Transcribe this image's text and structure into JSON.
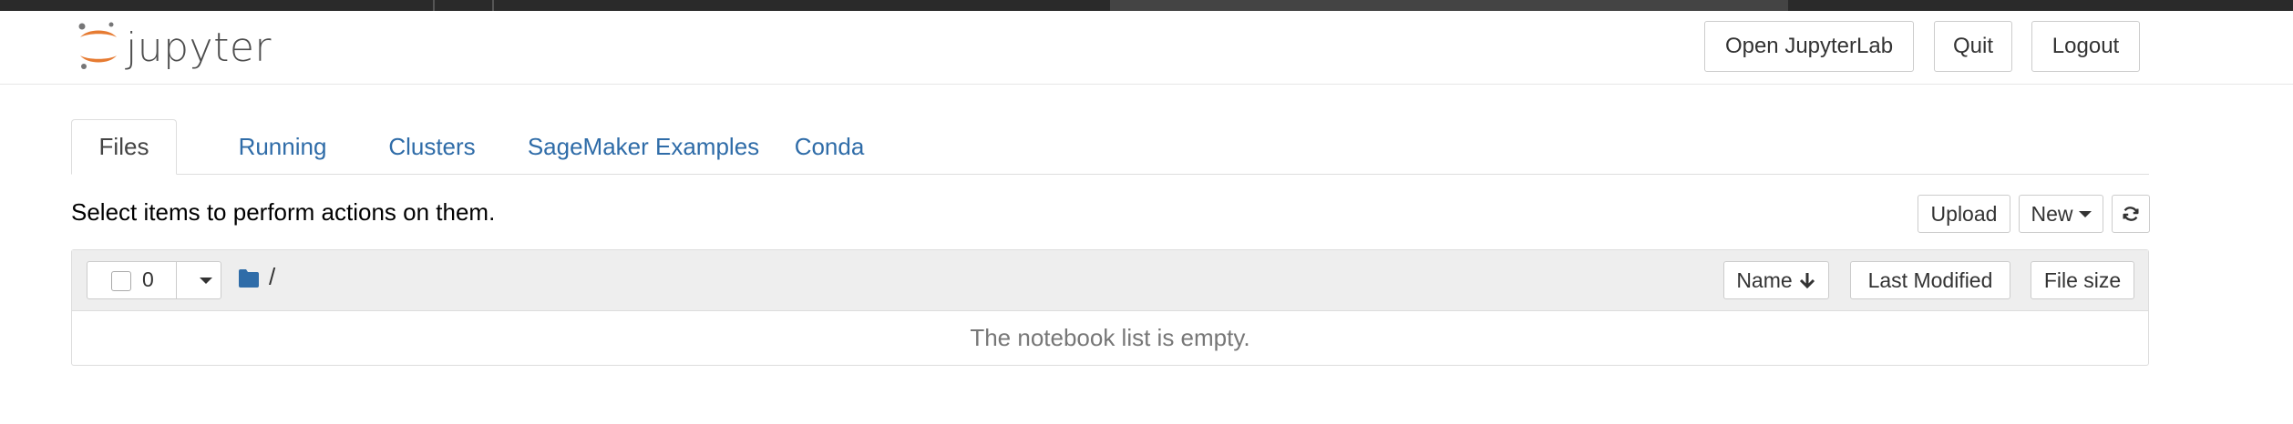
{
  "header": {
    "logo_text": "jupyter",
    "open_jupyterlab_label": "Open JupyterLab",
    "quit_label": "Quit",
    "logout_label": "Logout"
  },
  "tabs": [
    {
      "label": "Files",
      "active": true
    },
    {
      "label": "Running",
      "active": false
    },
    {
      "label": "Clusters",
      "active": false
    },
    {
      "label": "SageMaker Examples",
      "active": false
    },
    {
      "label": "Conda",
      "active": false
    }
  ],
  "toolbar": {
    "instructions": "Select items to perform actions on them.",
    "upload_label": "Upload",
    "new_label": "New",
    "refresh_icon": "refresh-icon"
  },
  "file_list": {
    "selected_count": "0",
    "path": "/",
    "columns": {
      "name": "Name",
      "last_modified": "Last Modified",
      "file_size": "File size"
    },
    "empty_message": "The notebook list is empty."
  },
  "colors": {
    "link_blue": "#2f6ca8",
    "jupyter_orange": "#e67b32",
    "folder_blue": "#2f6ca8",
    "header_gray": "#eeeeee"
  }
}
